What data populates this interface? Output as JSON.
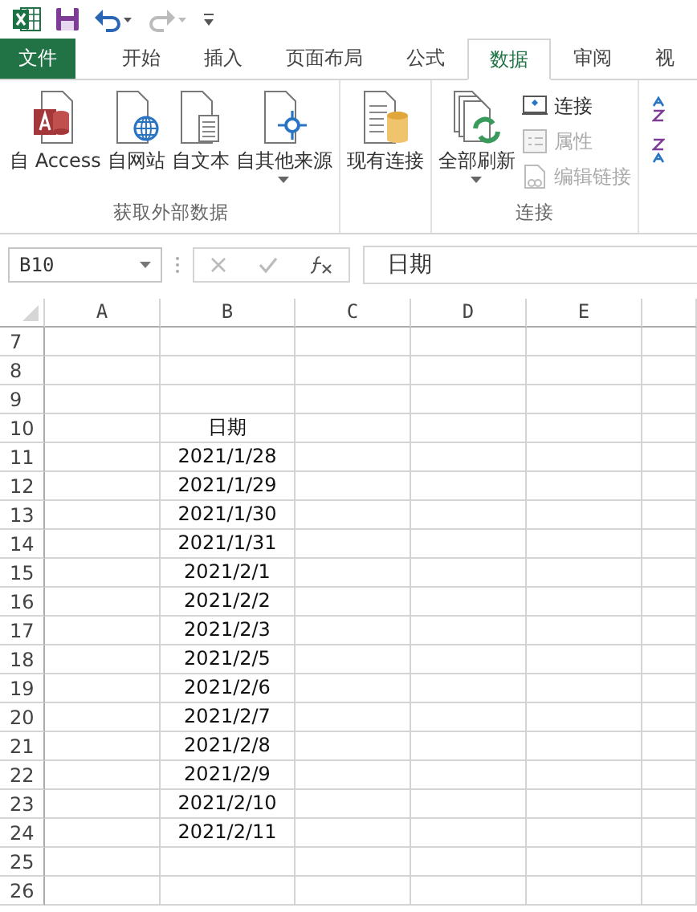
{
  "tabs": [
    {
      "label": "文件",
      "kind": "file",
      "selected": false
    },
    {
      "label": "开始",
      "kind": "tab",
      "selected": false
    },
    {
      "label": "插入",
      "kind": "tab",
      "selected": false
    },
    {
      "label": "页面布局",
      "kind": "tab",
      "selected": false
    },
    {
      "label": "公式",
      "kind": "tab",
      "selected": false
    },
    {
      "label": "数据",
      "kind": "tab",
      "selected": true
    },
    {
      "label": "审阅",
      "kind": "tab",
      "selected": false
    },
    {
      "label": "视",
      "kind": "tab",
      "selected": false
    }
  ],
  "ribbon": {
    "groups": [
      {
        "label": "获取外部数据",
        "buttons": [
          {
            "label": "自 Access",
            "kind": "access",
            "dropdown": false
          },
          {
            "label": "自网站",
            "kind": "web",
            "dropdown": false
          },
          {
            "label": "自文本",
            "kind": "text",
            "dropdown": false
          },
          {
            "label": "自其他来源",
            "kind": "other",
            "dropdown": true
          }
        ]
      },
      {
        "buttons": [
          {
            "label": "现有连接",
            "kind": "existing",
            "dropdown": false
          }
        ]
      },
      {
        "label": "连接",
        "buttons": [
          {
            "label": "全部刷新",
            "kind": "refresh",
            "dropdown": true
          }
        ],
        "small_buttons": [
          {
            "label": "连接",
            "kind": "connections",
            "disabled": false
          },
          {
            "label": "属性",
            "kind": "properties",
            "disabled": true
          },
          {
            "label": "编辑链接",
            "kind": "links",
            "disabled": true
          }
        ]
      }
    ]
  },
  "name_box": "B10",
  "formula": "日期",
  "columns": [
    "A",
    "B",
    "C",
    "D",
    "E"
  ],
  "rows": [
    {
      "number": "7"
    },
    {
      "number": "8"
    },
    {
      "number": "9"
    },
    {
      "number": "10",
      "b": "日期"
    },
    {
      "number": "11",
      "b": "2021/1/28"
    },
    {
      "number": "12",
      "b": "2021/1/29"
    },
    {
      "number": "13",
      "b": "2021/1/30"
    },
    {
      "number": "14",
      "b": "2021/1/31"
    },
    {
      "number": "15",
      "b": "2021/2/1"
    },
    {
      "number": "16",
      "b": "2021/2/2"
    },
    {
      "number": "17",
      "b": "2021/2/3"
    },
    {
      "number": "18",
      "b": "2021/2/5"
    },
    {
      "number": "19",
      "b": "2021/2/6"
    },
    {
      "number": "20",
      "b": "2021/2/7"
    },
    {
      "number": "21",
      "b": "2021/2/8"
    },
    {
      "number": "22",
      "b": "2021/2/9"
    },
    {
      "number": "23",
      "b": "2021/2/10"
    },
    {
      "number": "24",
      "b": "2021/2/11"
    },
    {
      "number": "25"
    },
    {
      "number": "26"
    }
  ]
}
